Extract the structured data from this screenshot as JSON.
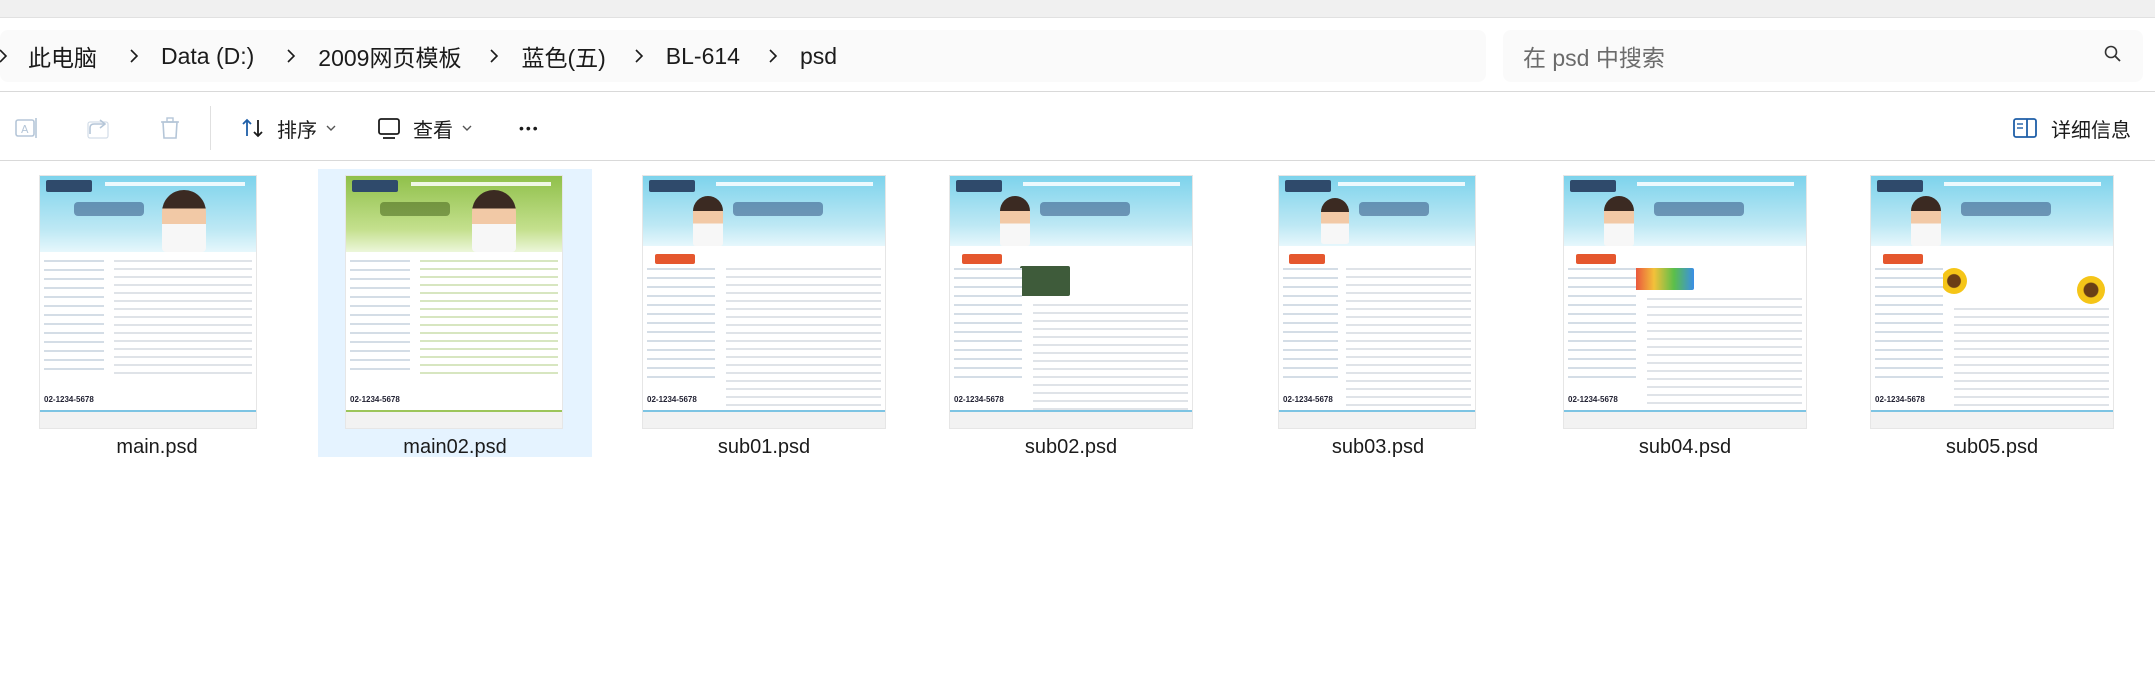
{
  "breadcrumb": {
    "items": [
      "此电脑",
      "Data (D:)",
      "2009网页模板",
      "蓝色(五)",
      "BL-614",
      "psd"
    ]
  },
  "search": {
    "placeholder": "在 psd 中搜索"
  },
  "toolbar": {
    "sort_label": "排序",
    "view_label": "查看",
    "more_label": "•••",
    "details_label": "详细信息"
  },
  "icons": {
    "breadcrumb_separator": "chevron-right-icon",
    "search": "search-icon",
    "rename": "rename-icon",
    "share": "share-icon",
    "delete": "trash-icon",
    "sort": "sort-icon",
    "view": "view-icon",
    "details": "details-pane-icon"
  },
  "files": [
    {
      "name": "main.psd",
      "selected": false
    },
    {
      "name": "main02.psd",
      "selected": true
    },
    {
      "name": "sub01.psd",
      "selected": false
    },
    {
      "name": "sub02.psd",
      "selected": false
    },
    {
      "name": "sub03.psd",
      "selected": false
    },
    {
      "name": "sub04.psd",
      "selected": false
    },
    {
      "name": "sub05.psd",
      "selected": false
    }
  ],
  "thumbnail_text": {
    "phone": "02-1234-5678"
  },
  "colors": {
    "selection": "#e5f3ff",
    "banner_blue": "#7dd3ec",
    "banner_green": "#8fc04a"
  }
}
